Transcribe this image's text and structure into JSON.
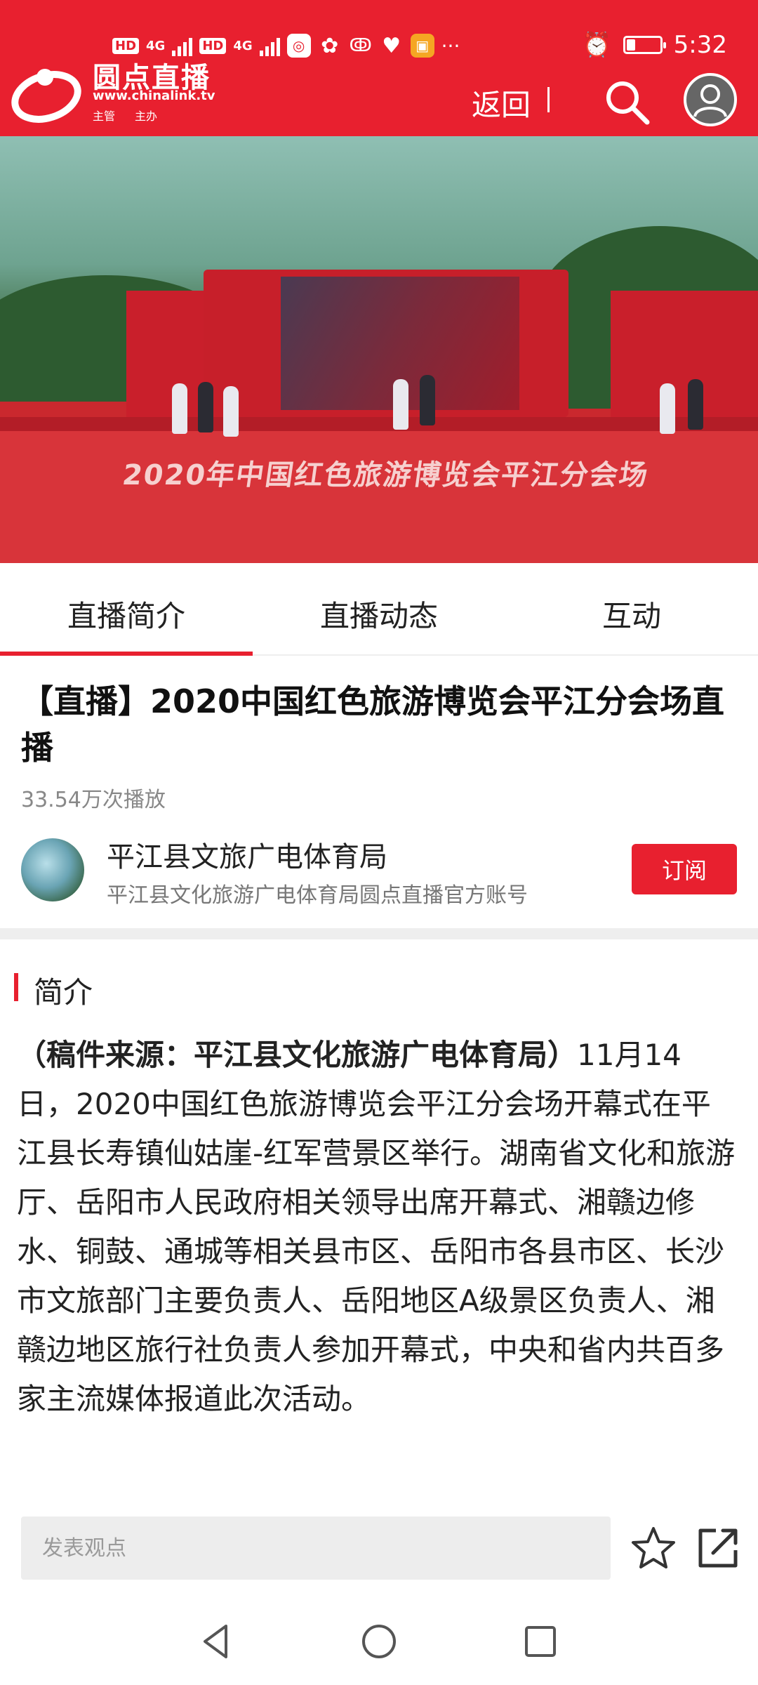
{
  "status_bar": {
    "hd_label_1": "HD",
    "hd_label_2": "HD",
    "network_1": "4G",
    "network_2": "4G",
    "more": "···",
    "time": "5:32",
    "battery_level": 0.25
  },
  "header": {
    "logo_text": "圆点直播",
    "logo_url": "www.chinalink.tv",
    "logo_sub_1": "主管",
    "logo_sub_2": "主办",
    "back_label": "返回",
    "search_icon": "search-icon",
    "user_icon": "user-icon",
    "background_color": "#e8202f"
  },
  "video": {
    "banner_text": "2020年中国红色旅游博览会平江分会场"
  },
  "tabs": [
    {
      "label": "直播简介",
      "active": true
    },
    {
      "label": "直播动态",
      "active": false
    },
    {
      "label": "互动",
      "active": false
    }
  ],
  "article": {
    "title": "【直播】2020中国红色旅游博览会平江分会场直播",
    "plays": "33.54万次播放"
  },
  "publisher": {
    "name": "平江县文旅广电体育局",
    "description": "平江县文化旅游广电体育局圆点直播官方账号",
    "subscribe_label": "订阅"
  },
  "intro": {
    "heading": "简介",
    "source": "（稿件来源：平江县文化旅游广电体育局）",
    "body": "11月14日，2020中国红色旅游博览会平江分会场开幕式在平江县长寿镇仙姑崖-红军营景区举行。湖南省文化和旅游厅、岳阳市人民政府相关领导出席开幕式、湘赣边修水、铜鼓、通城等相关县市区、岳阳市各县市区、长沙市文旅部门主要负责人、岳阳地区A级景区负责人、湘赣边地区旅行社负责人参加开幕式，中央和省内共百多家主流媒体报道此次活动。"
  },
  "comment_bar": {
    "placeholder": "发表观点",
    "favorite_icon": "star-icon",
    "share_icon": "share-icon"
  },
  "nav": {
    "back_icon": "triangle-back-icon",
    "home_icon": "circle-home-icon",
    "recents_icon": "square-recents-icon"
  }
}
